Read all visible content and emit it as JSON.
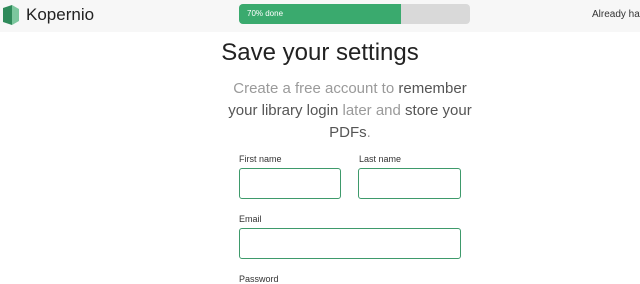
{
  "header": {
    "brand": "Kopernio",
    "progress": {
      "label": "70% done",
      "percent": 70
    },
    "already_text": "Already hav"
  },
  "main": {
    "title": "Save your settings",
    "subtitle": {
      "part1": "Create a free account to ",
      "part2": "remember your library login",
      "part3": " later and ",
      "part4": "store your PDFs",
      "part5": "."
    }
  },
  "form": {
    "first_name_label": "First name",
    "first_name_value": "",
    "last_name_label": "Last name",
    "last_name_value": "",
    "email_label": "Email",
    "email_value": "",
    "password_label": "Password"
  },
  "icons": {
    "logo": "kopernio-logo-icon"
  },
  "colors": {
    "accent": "#3aaa6e",
    "field_border": "#3e9a6b",
    "progress_track": "#d9d9d9"
  }
}
